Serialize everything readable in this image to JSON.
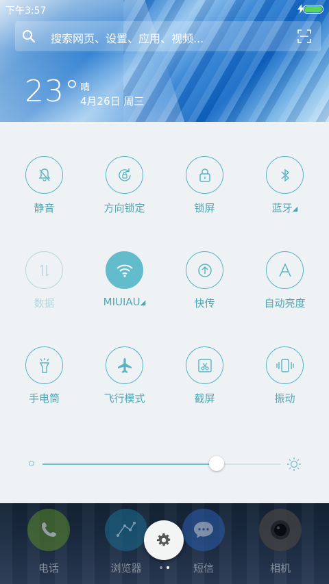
{
  "status": {
    "time": "下午3:57",
    "charging_icon": "bolt-icon",
    "battery_color": "#5bd35b"
  },
  "search": {
    "placeholder": "搜索网页、设置、应用、视频..."
  },
  "weather": {
    "temperature": "23°",
    "condition": "晴",
    "date": "4月26日 周三"
  },
  "toggles": [
    {
      "label": "静音",
      "icon": "bell-off-icon",
      "state": "off"
    },
    {
      "label": "方向锁定",
      "icon": "rotation-lock-icon",
      "state": "off"
    },
    {
      "label": "锁屏",
      "icon": "lock-icon",
      "state": "off"
    },
    {
      "label": "蓝牙",
      "icon": "bluetooth-icon",
      "state": "off"
    },
    {
      "label": "数据",
      "icon": "data-arrows-icon",
      "state": "disabled"
    },
    {
      "label": "MIUIAU",
      "icon": "wifi-icon",
      "state": "on"
    },
    {
      "label": "快传",
      "icon": "upload-icon",
      "state": "off"
    },
    {
      "label": "自动亮度",
      "icon": "auto-brightness-icon",
      "state": "off"
    },
    {
      "label": "手电筒",
      "icon": "flashlight-icon",
      "state": "off"
    },
    {
      "label": "飞行模式",
      "icon": "airplane-icon",
      "state": "off"
    },
    {
      "label": "截屏",
      "icon": "screenshot-icon",
      "state": "off"
    },
    {
      "label": "振动",
      "icon": "vibrate-icon",
      "state": "off"
    }
  ],
  "brightness": {
    "level": 0.73
  },
  "dock": [
    {
      "label": "电话",
      "icon": "phone-icon"
    },
    {
      "label": "浏览器",
      "icon": "browser-icon"
    },
    {
      "label": "短信",
      "icon": "sms-icon"
    },
    {
      "label": "相机",
      "icon": "camera-icon"
    }
  ],
  "settings_button": {
    "icon": "gear-icon"
  },
  "pager": {
    "pages": 2,
    "current": 1
  },
  "colors": {
    "accent": "#57b4c2",
    "active": "#63bccb",
    "panel_bg": "#eef2f4"
  }
}
